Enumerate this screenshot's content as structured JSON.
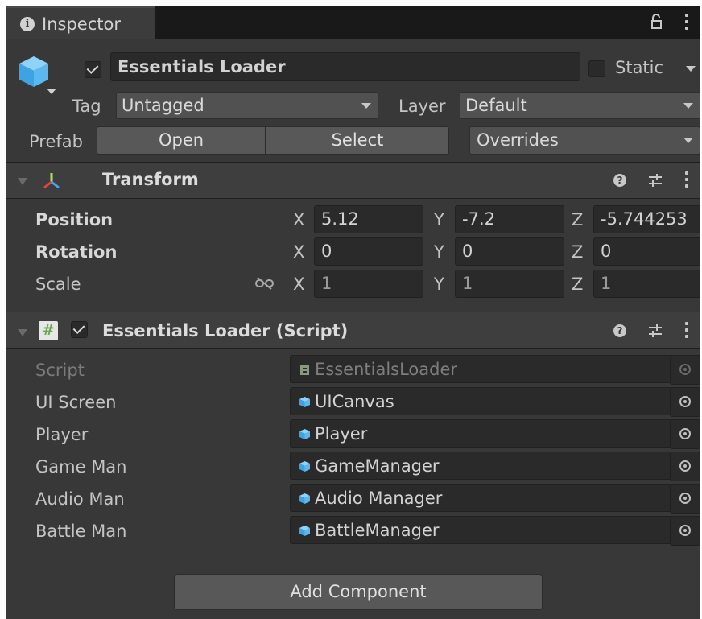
{
  "tab": {
    "title": "Inspector"
  },
  "object": {
    "active": true,
    "name": "Essentials Loader",
    "static_label": "Static"
  },
  "tag": {
    "label": "Tag",
    "value": "Untagged"
  },
  "layer": {
    "label": "Layer",
    "value": "Default"
  },
  "prefab": {
    "label": "Prefab",
    "open": "Open",
    "select": "Select",
    "overrides": "Overrides"
  },
  "transform": {
    "title": "Transform",
    "position": {
      "label": "Position",
      "x": "5.12",
      "y": "-7.2",
      "z": "-5.744253"
    },
    "rotation": {
      "label": "Rotation",
      "x": "0",
      "y": "0",
      "z": "0"
    },
    "scale": {
      "label": "Scale",
      "x": "1",
      "y": "1",
      "z": "1"
    },
    "axes": {
      "x": "X",
      "y": "Y",
      "z": "Z"
    }
  },
  "script_component": {
    "title": "Essentials Loader (Script)",
    "enabled": true,
    "script": {
      "label": "Script",
      "value": "EssentialsLoader"
    },
    "fields": [
      {
        "label": "UI Screen",
        "value": "UICanvas"
      },
      {
        "label": "Player",
        "value": "Player"
      },
      {
        "label": "Game Man",
        "value": "GameManager"
      },
      {
        "label": "Audio Man",
        "value": "Audio Manager"
      },
      {
        "label": "Battle Man",
        "value": "BattleManager"
      }
    ]
  },
  "add_component": {
    "label": "Add Component"
  },
  "colors": {
    "panel": "#383838",
    "field": "#2a2a2a",
    "cube": "#5bb8f0",
    "script_icon": "#8fc05f"
  }
}
